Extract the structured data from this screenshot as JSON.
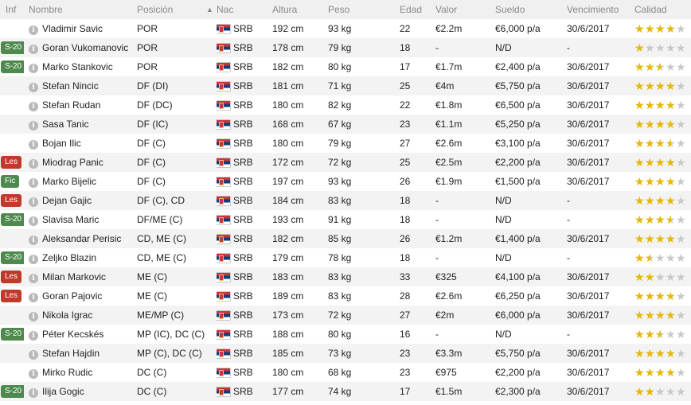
{
  "headers": {
    "inf": "Inf",
    "name": "Nombre",
    "position": "Posición",
    "sort_indicator": "▲",
    "nat": "Nac",
    "height": "Altura",
    "weight": "Peso",
    "age": "Edad",
    "value": "Valor",
    "wage": "Sueldo",
    "expiry": "Vencimiento",
    "quality": "Calidad"
  },
  "info_glyph": "i",
  "colors": {
    "star": "#e6b800",
    "badge_green": "#4e8a4e",
    "badge_red": "#c0392b"
  },
  "players": [
    {
      "badge": "",
      "name": "Vladimir Savic",
      "position": "POR",
      "nat": "SRB",
      "height": "192 cm",
      "weight": "93 kg",
      "age": "22",
      "value": "€2.2m",
      "wage": "€6,000 p/a",
      "expiry": "30/6/2017",
      "stars": 4
    },
    {
      "badge": "S-20",
      "name": "Goran Vukomanovic",
      "position": "POR",
      "nat": "SRB",
      "height": "178 cm",
      "weight": "79 kg",
      "age": "18",
      "value": "-",
      "wage": "N/D",
      "expiry": "-",
      "stars": 1
    },
    {
      "badge": "S-20",
      "name": "Marko Stankovic",
      "position": "POR",
      "nat": "SRB",
      "height": "182 cm",
      "weight": "80 kg",
      "age": "17",
      "value": "€1.7m",
      "wage": "€2,400 p/a",
      "expiry": "30/6/2017",
      "stars": 2.5
    },
    {
      "badge": "",
      "name": "Stefan Nincic",
      "position": "DF (DI)",
      "nat": "SRB",
      "height": "181 cm",
      "weight": "71 kg",
      "age": "25",
      "value": "€4m",
      "wage": "€5,750 p/a",
      "expiry": "30/6/2017",
      "stars": 4
    },
    {
      "badge": "",
      "name": "Stefan Rudan",
      "position": "DF (DC)",
      "nat": "SRB",
      "height": "180 cm",
      "weight": "82 kg",
      "age": "22",
      "value": "€1.8m",
      "wage": "€6,500 p/a",
      "expiry": "30/6/2017",
      "stars": 4
    },
    {
      "badge": "",
      "name": "Sasa Tanic",
      "position": "DF (IC)",
      "nat": "SRB",
      "height": "168 cm",
      "weight": "67 kg",
      "age": "23",
      "value": "€1.1m",
      "wage": "€5,250 p/a",
      "expiry": "30/6/2017",
      "stars": 4
    },
    {
      "badge": "",
      "name": "Bojan Ilic",
      "position": "DF (C)",
      "nat": "SRB",
      "height": "180 cm",
      "weight": "79 kg",
      "age": "27",
      "value": "€2.6m",
      "wage": "€3,100 p/a",
      "expiry": "30/6/2017",
      "stars": 3.5
    },
    {
      "badge": "Les",
      "name": "Miodrag Panic",
      "position": "DF (C)",
      "nat": "SRB",
      "height": "172 cm",
      "weight": "72 kg",
      "age": "25",
      "value": "€2.5m",
      "wage": "€2,200 p/a",
      "expiry": "30/6/2017",
      "stars": 4
    },
    {
      "badge": "Fic",
      "name": "Marko Bijelic",
      "position": "DF (C)",
      "nat": "SRB",
      "height": "197 cm",
      "weight": "93 kg",
      "age": "26",
      "value": "€1.9m",
      "wage": "€1,500 p/a",
      "expiry": "30/6/2017",
      "stars": 4
    },
    {
      "badge": "Les",
      "name": "Dejan Gajic",
      "position": "DF (C), CD",
      "nat": "SRB",
      "height": "184 cm",
      "weight": "83 kg",
      "age": "18",
      "value": "-",
      "wage": "N/D",
      "expiry": "-",
      "stars": 4
    },
    {
      "badge": "S-20",
      "name": "Slavisa Maric",
      "position": "DF/ME (C)",
      "nat": "SRB",
      "height": "193 cm",
      "weight": "91 kg",
      "age": "18",
      "value": "-",
      "wage": "N/D",
      "expiry": "-",
      "stars": 3.5
    },
    {
      "badge": "",
      "name": "Aleksandar Perisic",
      "position": "CD, ME (C)",
      "nat": "SRB",
      "height": "182 cm",
      "weight": "85 kg",
      "age": "26",
      "value": "€1.2m",
      "wage": "€1,400 p/a",
      "expiry": "30/6/2017",
      "stars": 4
    },
    {
      "badge": "S-20",
      "name": "Zeljko Blazin",
      "position": "CD, ME (C)",
      "nat": "SRB",
      "height": "179 cm",
      "weight": "78 kg",
      "age": "18",
      "value": "-",
      "wage": "N/D",
      "expiry": "-",
      "stars": 1.5
    },
    {
      "badge": "Les",
      "name": "Milan Markovic",
      "position": "ME (C)",
      "nat": "SRB",
      "height": "183 cm",
      "weight": "83 kg",
      "age": "33",
      "value": "€325",
      "wage": "€4,100 p/a",
      "expiry": "30/6/2017",
      "stars": 2
    },
    {
      "badge": "Les",
      "name": "Goran Pajovic",
      "position": "ME (C)",
      "nat": "SRB",
      "height": "189 cm",
      "weight": "83 kg",
      "age": "28",
      "value": "€2.6m",
      "wage": "€6,250 p/a",
      "expiry": "30/6/2017",
      "stars": 4
    },
    {
      "badge": "",
      "name": "Nikola Igrac",
      "position": "ME/MP (C)",
      "nat": "SRB",
      "height": "173 cm",
      "weight": "72 kg",
      "age": "27",
      "value": "€2m",
      "wage": "€6,000 p/a",
      "expiry": "30/6/2017",
      "stars": 4
    },
    {
      "badge": "S-20",
      "name": "Péter Kecskés",
      "position": "MP (IC), DC (C)",
      "nat": "SRB",
      "height": "188 cm",
      "weight": "80 kg",
      "age": "16",
      "value": "-",
      "wage": "N/D",
      "expiry": "-",
      "stars": 2.5
    },
    {
      "badge": "",
      "name": "Stefan Hajdin",
      "position": "MP (C), DC (C)",
      "nat": "SRB",
      "height": "185 cm",
      "weight": "73 kg",
      "age": "23",
      "value": "€3.3m",
      "wage": "€5,750 p/a",
      "expiry": "30/6/2017",
      "stars": 4
    },
    {
      "badge": "",
      "name": "Mirko Rudic",
      "position": "DC (C)",
      "nat": "SRB",
      "height": "180 cm",
      "weight": "68 kg",
      "age": "23",
      "value": "€975",
      "wage": "€2,200 p/a",
      "expiry": "30/6/2017",
      "stars": 4
    },
    {
      "badge": "S-20",
      "name": "Ilija Gogic",
      "position": "DC (C)",
      "nat": "SRB",
      "height": "177 cm",
      "weight": "74 kg",
      "age": "17",
      "value": "€1.5m",
      "wage": "€2,300 p/a",
      "expiry": "30/6/2017",
      "stars": 2
    }
  ]
}
